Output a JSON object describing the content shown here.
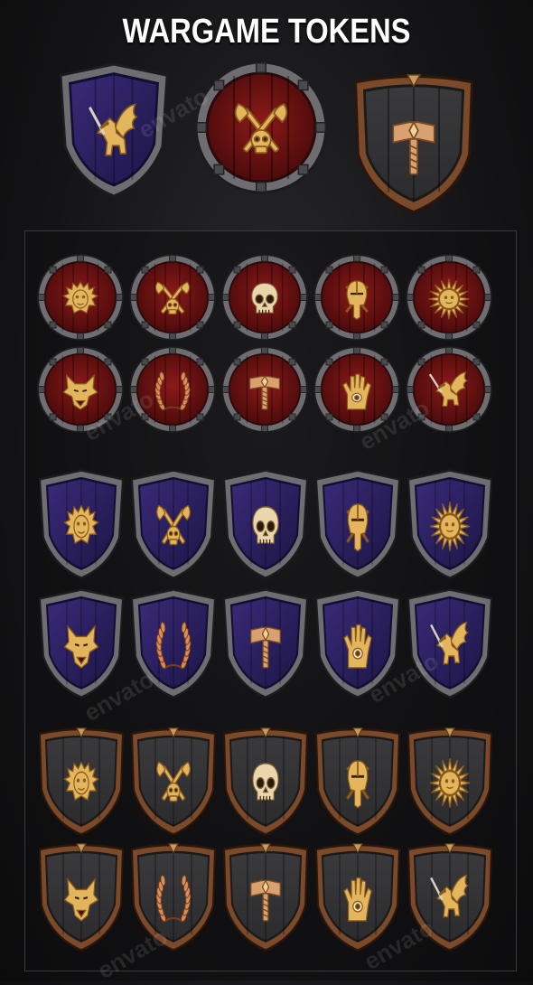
{
  "title": "WARGAME TOKENS",
  "watermark": "envato",
  "palette": {
    "gold": "#e3b55c",
    "gold_dark": "#8a5a1c",
    "red": "#8c1a1a",
    "red_dark": "#4d0b0b",
    "blue": "#3a2a78",
    "blue_dark": "#1c1646",
    "wood_dark": "#2c2c2e",
    "iron": "#6d6d72",
    "bronze": "#7a4a2a"
  },
  "emblems": [
    "lion-icon",
    "axes-skull-icon",
    "skull-icon",
    "helmet-icon",
    "sun-icon",
    "wolf-icon",
    "laurel-wreath-icon",
    "hammer-icon",
    "eye-hand-icon",
    "griffin-icon"
  ],
  "showcase": [
    {
      "style": "blue-shield",
      "emblem": "griffin-icon"
    },
    {
      "style": "red-round",
      "emblem": "axes-skull-icon"
    },
    {
      "style": "dark-shield",
      "emblem": "hammer-icon"
    }
  ],
  "sets": [
    {
      "style": "red-round",
      "rows": [
        [
          "lion-icon",
          "axes-skull-icon",
          "skull-icon",
          "helmet-icon",
          "sun-icon"
        ],
        [
          "wolf-icon",
          "laurel-wreath-icon",
          "hammer-icon",
          "eye-hand-icon",
          "griffin-icon"
        ]
      ]
    },
    {
      "style": "blue-shield",
      "rows": [
        [
          "lion-icon",
          "axes-skull-icon",
          "skull-icon",
          "helmet-icon",
          "sun-icon"
        ],
        [
          "wolf-icon",
          "laurel-wreath-icon",
          "hammer-icon",
          "eye-hand-icon",
          "griffin-icon"
        ]
      ]
    },
    {
      "style": "dark-shield",
      "rows": [
        [
          "lion-icon",
          "axes-skull-icon",
          "skull-icon",
          "helmet-icon",
          "sun-icon"
        ],
        [
          "wolf-icon",
          "laurel-wreath-icon",
          "hammer-icon",
          "eye-hand-icon",
          "griffin-icon"
        ]
      ]
    }
  ]
}
